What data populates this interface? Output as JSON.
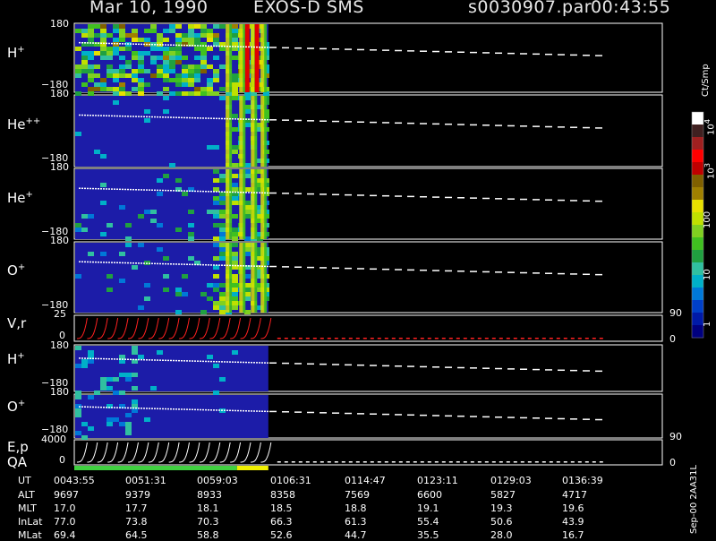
{
  "header": {
    "date": "Mar 10, 1990",
    "instrument": "EXOS-D SMS",
    "file": "s0030907.par",
    "time": "00:43:55"
  },
  "panels": [
    {
      "label": "H",
      "sup": "+",
      "top": "180",
      "bottom": "−180"
    },
    {
      "label": "He",
      "sup": "++",
      "top": "180",
      "bottom": "−180"
    },
    {
      "label": "He",
      "sup": "+",
      "top": "180",
      "bottom": "−180"
    },
    {
      "label": "O",
      "sup": "+",
      "top": "180",
      "bottom": "−180"
    },
    {
      "label": "V,r",
      "sup": "",
      "top": "25",
      "bottom": "0",
      "right_top": "90",
      "right_bottom": "0"
    },
    {
      "label": "H",
      "sup": "+",
      "top": "180",
      "bottom": "−180"
    },
    {
      "label": "O",
      "sup": "+",
      "top": "180",
      "bottom": "−180"
    },
    {
      "label": "E,p",
      "sup": "",
      "top": "4000",
      "bottom": "0",
      "right_top": "90",
      "right_bottom": "0"
    }
  ],
  "qa_label": "QA",
  "colorbar": {
    "unit": "Ct/Smp",
    "labels": [
      {
        "text": "10",
        "sup": "4"
      },
      {
        "text": "10",
        "sup": "3"
      },
      {
        "text": "100",
        "sup": ""
      },
      {
        "text": "10",
        "sup": ""
      },
      {
        "text": "1",
        "sup": ""
      }
    ],
    "colors": [
      "#000080",
      "#001aa8",
      "#0040c8",
      "#0078d8",
      "#00b0c8",
      "#30c0a0",
      "#20a040",
      "#40c020",
      "#80d020",
      "#c0e000",
      "#e8e000",
      "#a08000",
      "#806000",
      "#c00000",
      "#ff0000",
      "#a02020",
      "#402020",
      "#ffffff"
    ]
  },
  "footer_stamp": "Sep-00  2AA31L",
  "table": {
    "rows": [
      {
        "label": "UT",
        "values": [
          "0043:55",
          "0051:31",
          "0059:03",
          "0106:31",
          "0114:47",
          "0123:11",
          "0129:03",
          "0136:39"
        ]
      },
      {
        "label": "ALT",
        "values": [
          "9697",
          "9379",
          "8933",
          "8358",
          "7569",
          "6600",
          "5827",
          "4717"
        ]
      },
      {
        "label": "MLT",
        "values": [
          "17.0",
          "17.7",
          "18.1",
          "18.5",
          "18.8",
          "19.1",
          "19.3",
          "19.6"
        ]
      },
      {
        "label": "InLat",
        "values": [
          "77.0",
          "73.8",
          "70.3",
          "66.3",
          "61.3",
          "55.4",
          "50.6",
          "43.9"
        ]
      },
      {
        "label": "MLat",
        "values": [
          "69.4",
          "64.5",
          "58.8",
          "52.6",
          "44.7",
          "35.5",
          "28.0",
          "16.7"
        ]
      }
    ]
  },
  "chart_data": {
    "type": "heatmap",
    "title": "Mar 10, 1990   EXOS-D SMS",
    "x_ticks": [
      "0043:55",
      "0051:31",
      "0059:03",
      "0106:31",
      "0114:47",
      "0123:11",
      "0129:03",
      "0136:39"
    ],
    "panels": [
      "H+",
      "He++",
      "He+",
      "O+",
      "V,r",
      "H+",
      "O+",
      "E,p"
    ],
    "pitch_angle_range": [
      -180,
      180
    ],
    "velocity_range": [
      0,
      25
    ],
    "energy_range": [
      0,
      4000
    ],
    "colorbar_range": [
      1,
      10000
    ],
    "colorbar_scale": "log",
    "data_end_fraction": 0.33
  }
}
